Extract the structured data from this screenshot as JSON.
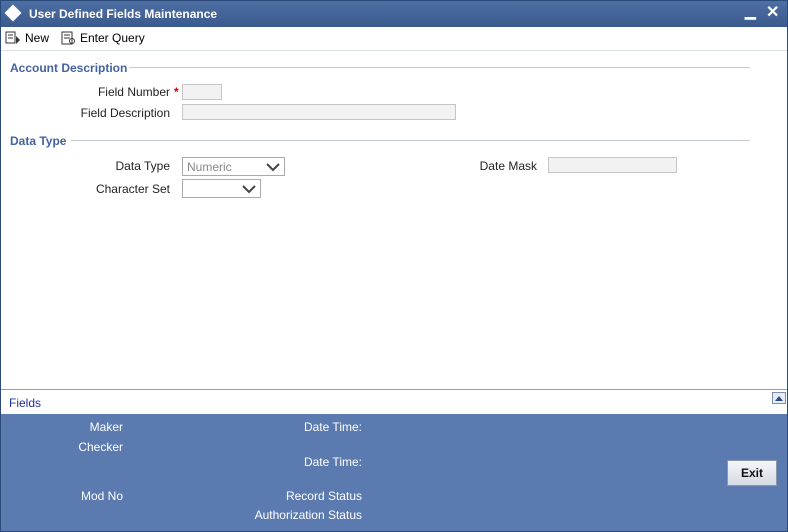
{
  "window": {
    "title": "User Defined Fields Maintenance"
  },
  "toolbar": {
    "new_label": "New",
    "enter_query_label": "Enter Query"
  },
  "account_description": {
    "section_title": "Account Description",
    "field_number_label": "Field Number",
    "required_mark": "*",
    "field_number_value": "",
    "field_description_label": "Field Description",
    "field_description_value": ""
  },
  "data_type": {
    "section_title": "Data Type",
    "data_type_label": "Data Type",
    "data_type_value": "Numeric",
    "character_set_label": "Character Set",
    "character_set_value": "",
    "date_mask_label": "Date Mask",
    "date_mask_value": ""
  },
  "fields_bar": {
    "label": "Fields"
  },
  "footer": {
    "maker_label": "Maker",
    "checker_label": "Checker",
    "date_time_label_1": "Date Time:",
    "date_time_label_2": "Date Time:",
    "mod_no_label": "Mod No",
    "record_status_label": "Record Status",
    "authorization_status_label": "Authorization Status",
    "exit_label": "Exit"
  },
  "colors": {
    "title_bar": "#3a5a8e",
    "section_title": "#4463a0",
    "footer": "#5b7ab0",
    "required": "#cc0000"
  },
  "icons": [
    "diamond-icon",
    "minimize-icon",
    "close-icon",
    "new-icon",
    "enter-query-icon",
    "chevron-down-icon",
    "collapse-arrow-icon"
  ]
}
